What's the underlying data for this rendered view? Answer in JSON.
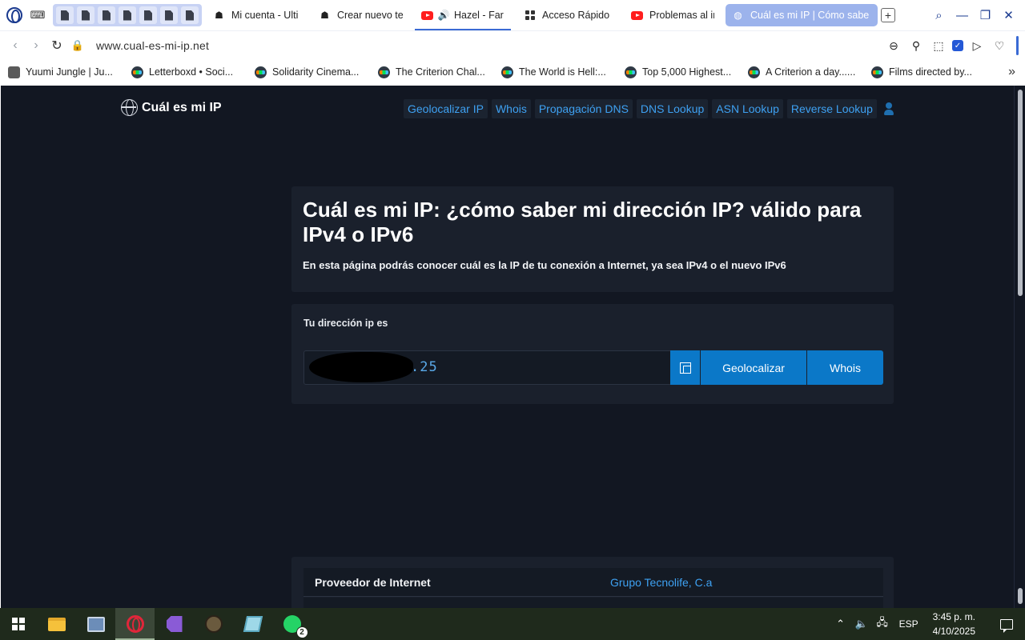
{
  "browser": {
    "tabs": [
      {
        "title": "Mi cuenta - Ulti",
        "favicon": "ultimate-guitar-icon"
      },
      {
        "title": "Crear nuevo te",
        "favicon": "ultimate-guitar-icon"
      },
      {
        "title": "Hazel - Far",
        "favicon": "youtube-icon",
        "playing": true
      },
      {
        "title": "Acceso Rápido",
        "favicon": "speed-dial-icon"
      },
      {
        "title": "Problemas al in",
        "favicon": "youtube-icon"
      },
      {
        "title": "Cuál es mi IP | Cómo sabe",
        "favicon": "globe-icon",
        "active": true
      }
    ],
    "url": "www.cual-es-mi-ip.net",
    "accent_color": "#3a6ad4"
  },
  "bookmarks": [
    {
      "label": "Yuumi Jungle | Ju...",
      "favicon": "yuumi-icon"
    },
    {
      "label": "Letterboxd • Soci...",
      "favicon": "letterboxd-icon"
    },
    {
      "label": "Solidarity Cinema...",
      "favicon": "letterboxd-icon"
    },
    {
      "label": "The Criterion Chal...",
      "favicon": "letterboxd-icon"
    },
    {
      "label": "The World is Hell:...",
      "favicon": "letterboxd-icon"
    },
    {
      "label": "Top 5,000 Highest...",
      "favicon": "letterboxd-icon"
    },
    {
      "label": "A Criterion a day......",
      "favicon": "letterboxd-icon"
    },
    {
      "label": "Films directed by...",
      "favicon": "letterboxd-icon"
    }
  ],
  "site": {
    "logo_text": "Cuál es mi IP",
    "nav": [
      "Geolocalizar IP",
      "Whois",
      "Propagación DNS",
      "DNS Lookup",
      "ASN Lookup",
      "Reverse Lookup"
    ],
    "title": "Cuál es mi IP: ¿cómo saber mi dirección IP? válido para IPv4 o IPv6",
    "subtitle": "En esta página podrás conocer cuál es la IP de tu conexión a Internet, ya sea IPv4 o el nuevo IPv6",
    "ip_label": "Tu dirección ip es",
    "ip_visible_suffix": ".25",
    "geolocate_label": "Geolocalizar",
    "whois_label": "Whois",
    "info_rows": [
      {
        "key": "Proveedor de Internet",
        "value": "Grupo Tecnolife, C.a"
      }
    ],
    "colors": {
      "background": "#121722",
      "card": "#1a202c",
      "link": "#3ea1f2",
      "button": "#0b78c8"
    }
  },
  "taskbar": {
    "apps": [
      "file-explorer-icon",
      "control-panel-icon",
      "opera-icon",
      "visual-studio-icon",
      "game-icon",
      "notes-icon",
      "whatsapp-icon"
    ],
    "whatsapp_badge": "2",
    "language": "ESP",
    "time": "3:45 p. m.",
    "date": "4/10/2025"
  }
}
